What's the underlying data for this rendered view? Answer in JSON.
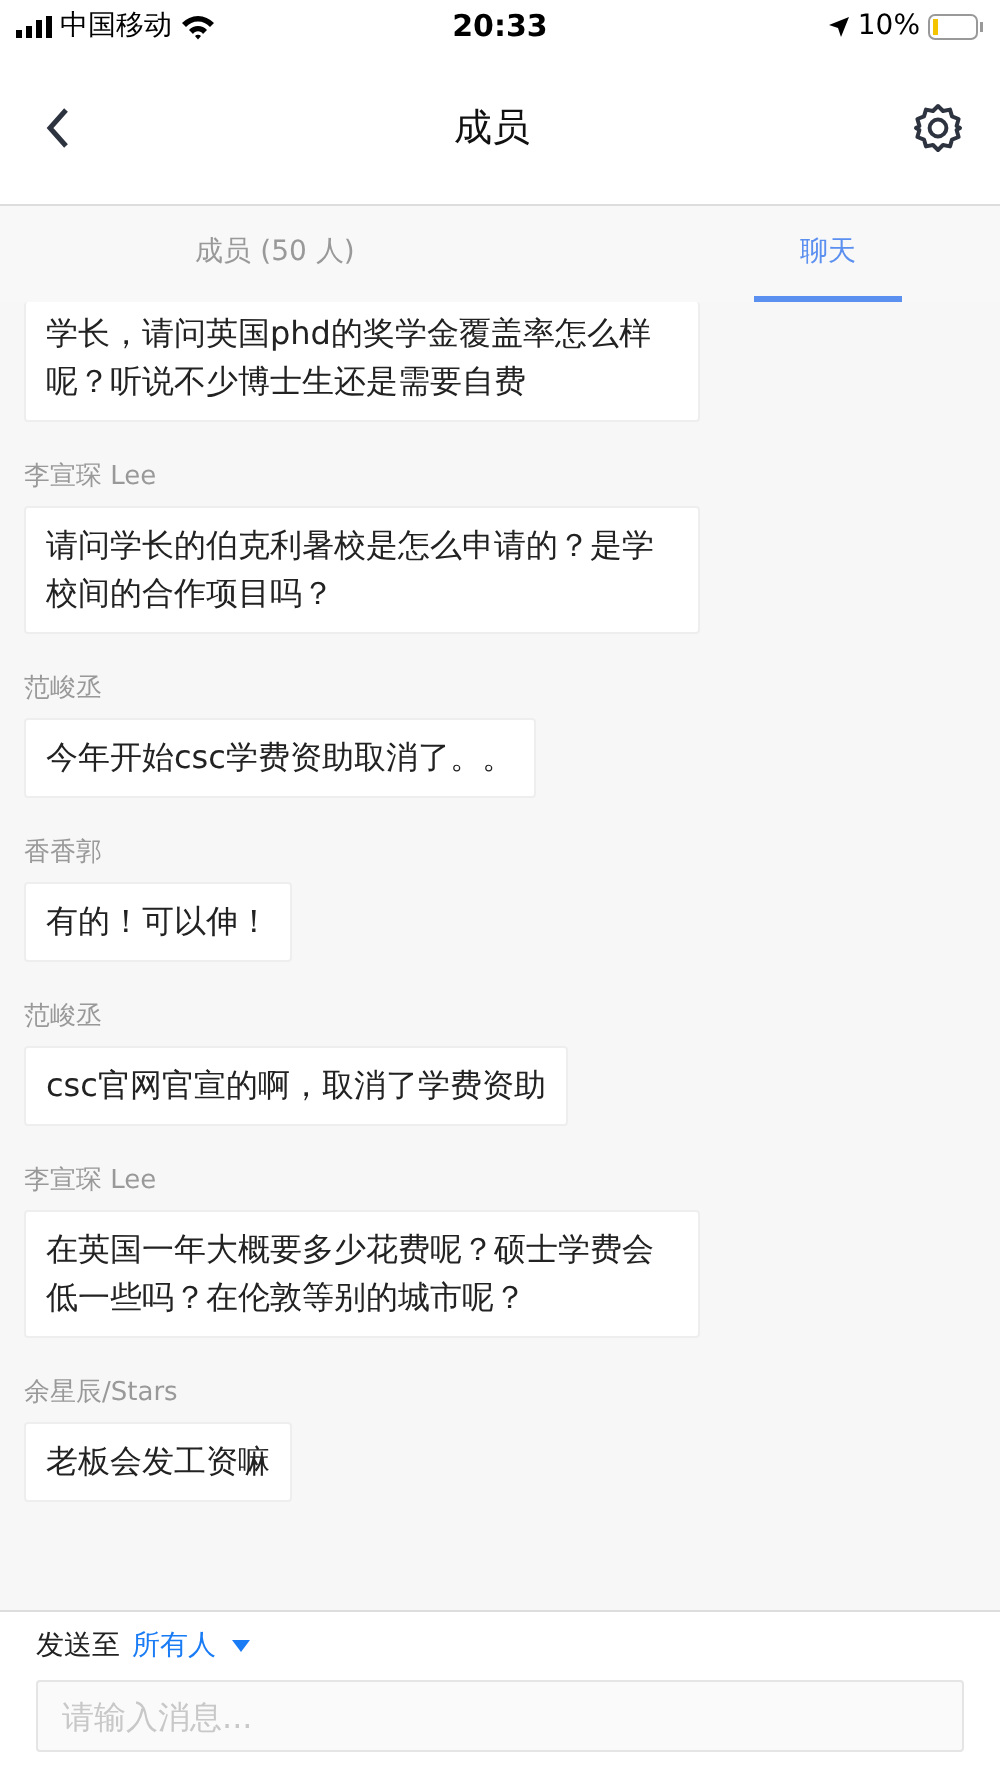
{
  "status_bar": {
    "carrier": "中国移动",
    "time": "20:33",
    "battery": "10%"
  },
  "nav": {
    "title": "成员"
  },
  "tabs": [
    {
      "label": "成员 (50 人)",
      "selected": false
    },
    {
      "label": "聊天",
      "selected": true
    }
  ],
  "messages": [
    {
      "text": "学长，请问英国phd的奖学金覆盖率怎么样呢？听说不少博士生还是需要自费"
    },
    {
      "sender": "李宣琛 Lee",
      "text": "请问学长的伯克利暑校是怎么申请的？是学校间的合作项目吗？"
    },
    {
      "sender": "范峻丞",
      "text": "今年开始csc学费资助取消了。。"
    },
    {
      "sender": "香香郭",
      "text": "有的！可以伸！"
    },
    {
      "sender": "范峻丞",
      "text": "csc官网官宣的啊，取消了学费资助"
    },
    {
      "sender": "李宣琛 Lee",
      "text": "在英国一年大概要多少花费呢？硕士学费会低一些吗？在伦敦等别的城市呢？"
    },
    {
      "sender": "余星辰/Stars",
      "text": "老板会发工资嘛"
    }
  ],
  "composer": {
    "send_to_label": "发送至",
    "recipient": "所有人",
    "placeholder": "请输入消息..."
  }
}
